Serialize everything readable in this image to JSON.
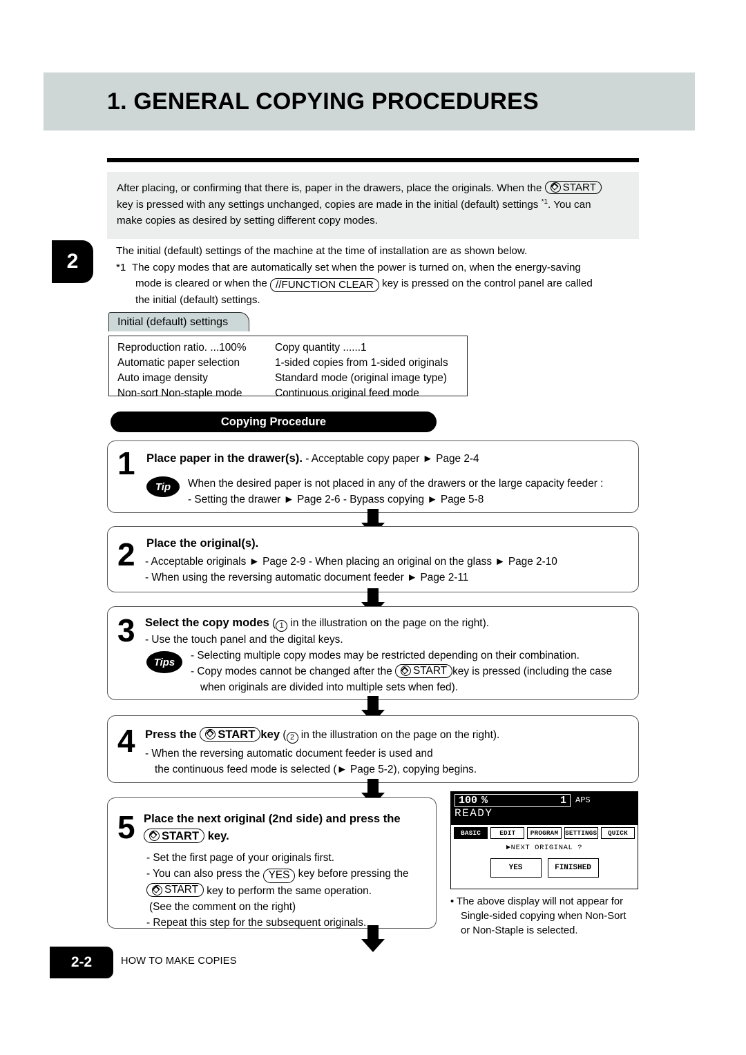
{
  "header": {
    "title": "1. GENERAL COPYING PROCEDURES",
    "band_color": "#ced6d6"
  },
  "chapter_tab": {
    "number": "2"
  },
  "intro": {
    "line1_a": "After placing, or confirming that there is, paper in the drawers, place the originals. When the ",
    "start_key": "START",
    "line1_b": "",
    "line2": "key is pressed with any settings unchanged, copies are made in the initial (default) settings ",
    "footnote_mark": "*1",
    "line2_b": ". You can",
    "line3": "make copies as desired by setting different copy modes."
  },
  "note": {
    "line1": "The initial (default) settings of the machine at the time of installation are as shown below.",
    "mark": "*1",
    "line2_a": "The copy modes that are automatically set when the power is turned on, when the energy-saving",
    "line3_a": "mode is cleared or when the ",
    "function_clear_key": "//FUNCTION CLEAR",
    "line3_b": " key is pressed on the control panel are called",
    "line4": "the initial (default) settings."
  },
  "settings": {
    "tab_label": "Initial (default) settings",
    "rows": [
      {
        "left": "Reproduction ratio. ...100%",
        "right": "Copy quantity ......1"
      },
      {
        "left": "Automatic paper selection",
        "right": "1-sided copies from 1-sided originals"
      },
      {
        "left": "Auto image density",
        "right": "Standard mode (original image type)"
      },
      {
        "left": "Non-sort Non-staple mode",
        "right": "Continuous original feed mode"
      }
    ]
  },
  "procedure": {
    "pill_label": "Copying Procedure",
    "steps": [
      {
        "number": "1",
        "title": "Place paper in the drawer(s).",
        "title_tail": "- Acceptable copy paper ► Page 2-4",
        "tip_label": "Tip",
        "tip_line1": "When the desired paper is not placed in any of the drawers or the large capacity feeder :",
        "tip_line2": "- Setting the drawer ► Page 2-6      - Bypass copying ► Page 5-8"
      },
      {
        "number": "2",
        "title": "Place the original(s).",
        "line1": "- Acceptable originals ► Page 2-9    - When placing an original on the glass ► Page 2-10",
        "line2": "- When using the reversing automatic document feeder ► Page 2-11"
      },
      {
        "number": "3",
        "title": "Select the copy modes",
        "title_tail_a": " (",
        "title_circle": "1",
        "title_tail_b": " in the illustration on the page on the right).",
        "line1": "- Use the touch panel and the digital keys.",
        "tips_label": "Tips",
        "tip_line1": "-  Selecting multiple copy modes may be restricted depending on their combination.",
        "tip_line2_a": "-  Copy modes cannot be changed after the ",
        "tip_start_key": "START",
        "tip_line2_b": "key is pressed (including the case",
        "tip_line3": "when originals are divided into multiple sets when fed)."
      },
      {
        "number": "4",
        "title_a": "Press the ",
        "start_key": "START",
        "title_b": "key",
        "title_tail_a": " (",
        "title_circle": "2",
        "title_tail_b": " in the illustration on the page on the right).",
        "line1": "-  When the reversing automatic document feeder is used and",
        "line2": "the continuous feed mode is selected (► Page 5-2), copying begins."
      },
      {
        "number": "5",
        "title_line1": "Place the next original (2nd side) and press the",
        "start_key": "START",
        "title_line2_tail": " key.",
        "line1": "-  Set the first page of your originals first.",
        "line2_a": "- You can also press the ",
        "yes_key": "YES",
        "line2_b": " key before pressing the",
        "line3_a": "",
        "line3_start_key": "START",
        "line3_b": " key to perform the same operation.",
        "line4": "(See the comment on the right)",
        "line5": "-  Repeat this step for the subsequent originals."
      }
    ]
  },
  "lcd": {
    "ratio": "100",
    "percent": "%",
    "quantity": "1",
    "paper_mode": "APS",
    "status": "READY",
    "tabs": [
      {
        "label": "BASIC",
        "selected": true
      },
      {
        "label": "EDIT",
        "selected": false
      },
      {
        "label": "PROGRAM",
        "selected": false
      },
      {
        "label": "SETTINGS",
        "selected": false
      },
      {
        "label": "QUICK",
        "selected": false
      }
    ],
    "prompt": "►NEXT ORIGINAL ?",
    "buttons": [
      "YES",
      "FINISHED"
    ],
    "note_line1": "• The above display will not appear for",
    "note_line2": "Single-sided copying when Non-Sort",
    "note_line3": "or Non-Staple is selected."
  },
  "footer": {
    "page_number": "2-2",
    "section": "HOW TO MAKE COPIES"
  }
}
